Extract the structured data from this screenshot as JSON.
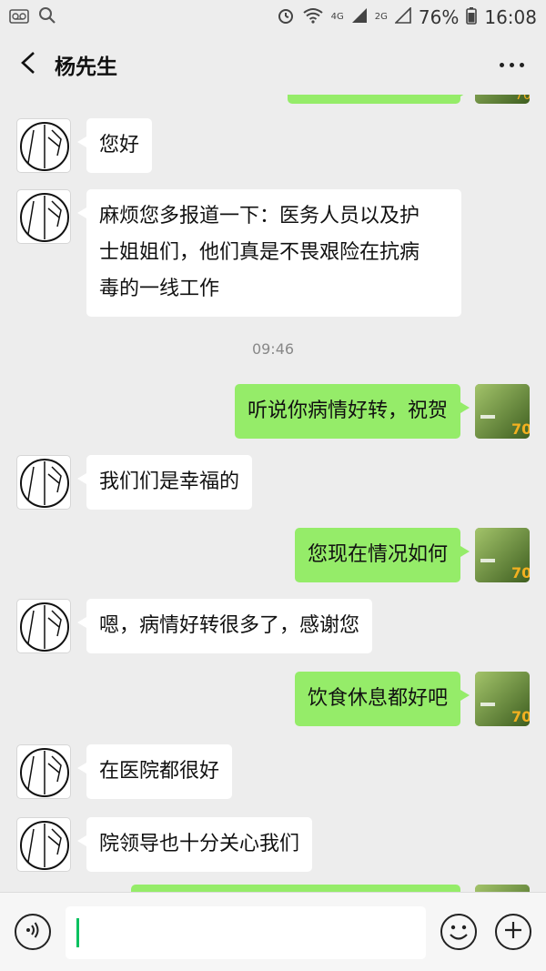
{
  "status_bar": {
    "network": "4G",
    "network2": "2G",
    "battery": "76%",
    "time": "16:08"
  },
  "header": {
    "title": "杨先生"
  },
  "messages": [
    {
      "side": "left",
      "text": "您好"
    },
    {
      "side": "left",
      "lines": [
        "麻烦您多报道一下：医务人员以及护",
        "士姐姐们，他们真是不畏艰险在抗病",
        "毒的一线工作"
      ]
    },
    {
      "timestamp": "09:46"
    },
    {
      "side": "right",
      "text": "听说你病情好转，祝贺"
    },
    {
      "side": "left",
      "text": "我们们是幸福的"
    },
    {
      "side": "right",
      "text": "您现在情况如何"
    },
    {
      "side": "left",
      "text": "嗯，病情好转很多了，感谢您"
    },
    {
      "side": "right",
      "text": "饮食休息都好吧"
    },
    {
      "side": "left",
      "text": "在医院都很好"
    },
    {
      "side": "left",
      "text": "院领导也十分关心我们"
    }
  ],
  "input": {
    "value": ""
  },
  "icons": {
    "back": "chevron-left-icon",
    "more": "more-horizontal-icon",
    "voice": "voice-icon",
    "emoji": "emoji-icon",
    "plus": "plus-icon"
  },
  "colors": {
    "background": "#ededed",
    "sent_bubble": "#95ec69",
    "received_bubble": "#ffffff",
    "cursor": "#07c160"
  }
}
